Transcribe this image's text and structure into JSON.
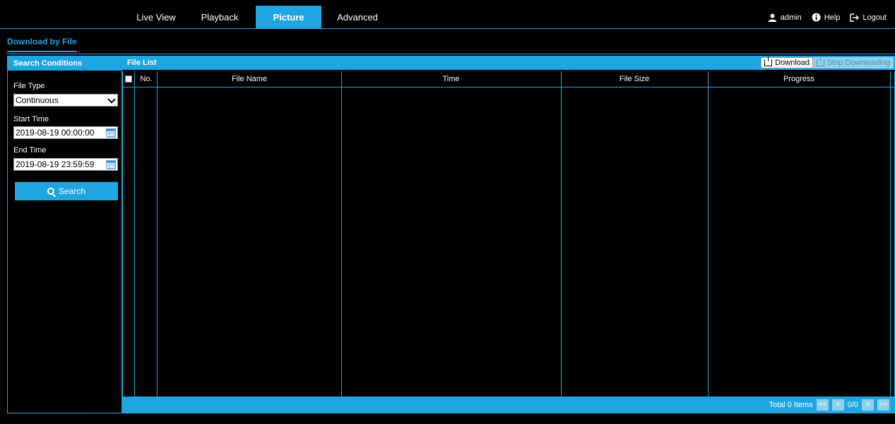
{
  "nav": {
    "tabs": [
      {
        "label": "Live View"
      },
      {
        "label": "Playback"
      },
      {
        "label": "Picture"
      },
      {
        "label": "Advanced"
      }
    ],
    "active_tab": "Picture",
    "user": "admin",
    "help": "Help",
    "logout": "Logout"
  },
  "subnav": {
    "tab": "Download by File"
  },
  "search_panel": {
    "title": "Search Conditions",
    "file_type_label": "File Type",
    "file_type_value": "Continuous",
    "start_time_label": "Start Time",
    "start_time_value": "2019-08-19 00:00:00",
    "end_time_label": "End Time",
    "end_time_value": "2019-08-19 23:59:59",
    "search_button": "Search"
  },
  "file_list": {
    "title": "File List",
    "download_button": "Download",
    "stop_downloading_button": "Stop Downloading",
    "columns": [
      "No.",
      "File Name",
      "Time",
      "File Size",
      "Progress"
    ],
    "rows": []
  },
  "pager": {
    "total": "Total 0 Items",
    "first": "<<",
    "prev": "<",
    "page": "0/0",
    "next": ">",
    "last": ">>"
  },
  "colors": {
    "accent": "#1fa5e0",
    "background": "#000000"
  }
}
